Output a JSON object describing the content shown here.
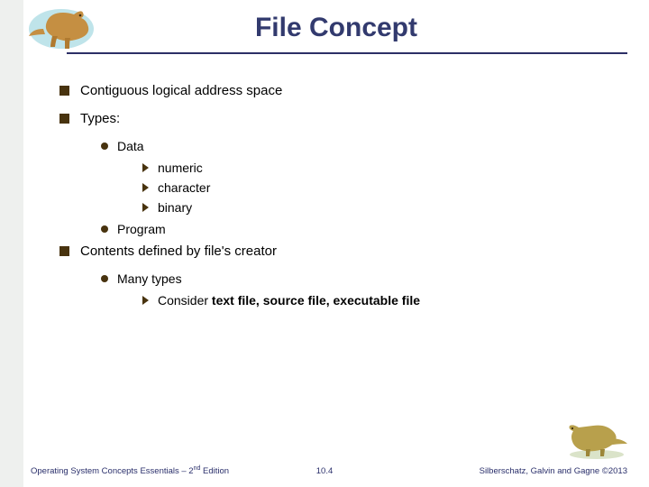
{
  "title": "File Concept",
  "bullets": {
    "b1": "Contiguous logical address space",
    "b2": "Types:",
    "b2a": "Data",
    "b2a1": "numeric",
    "b2a2": "character",
    "b2a3": "binary",
    "b2b": "Program",
    "b3": "Contents defined by file's creator",
    "b3a": "Many types",
    "b3a1_prefix": "Consider ",
    "b3a1_bold": "text file, source file, executable file"
  },
  "footer": {
    "left_book": "Operating System Concepts Essentials – 2",
    "left_sup": "nd",
    "left_suffix": " Edition",
    "center": "10.4",
    "right": "Silberschatz, Galvin and Gagne ©2013"
  },
  "icons": {
    "logo_top": "dinosaur-illustration-top",
    "logo_bottom": "dinosaur-illustration-bottom"
  }
}
